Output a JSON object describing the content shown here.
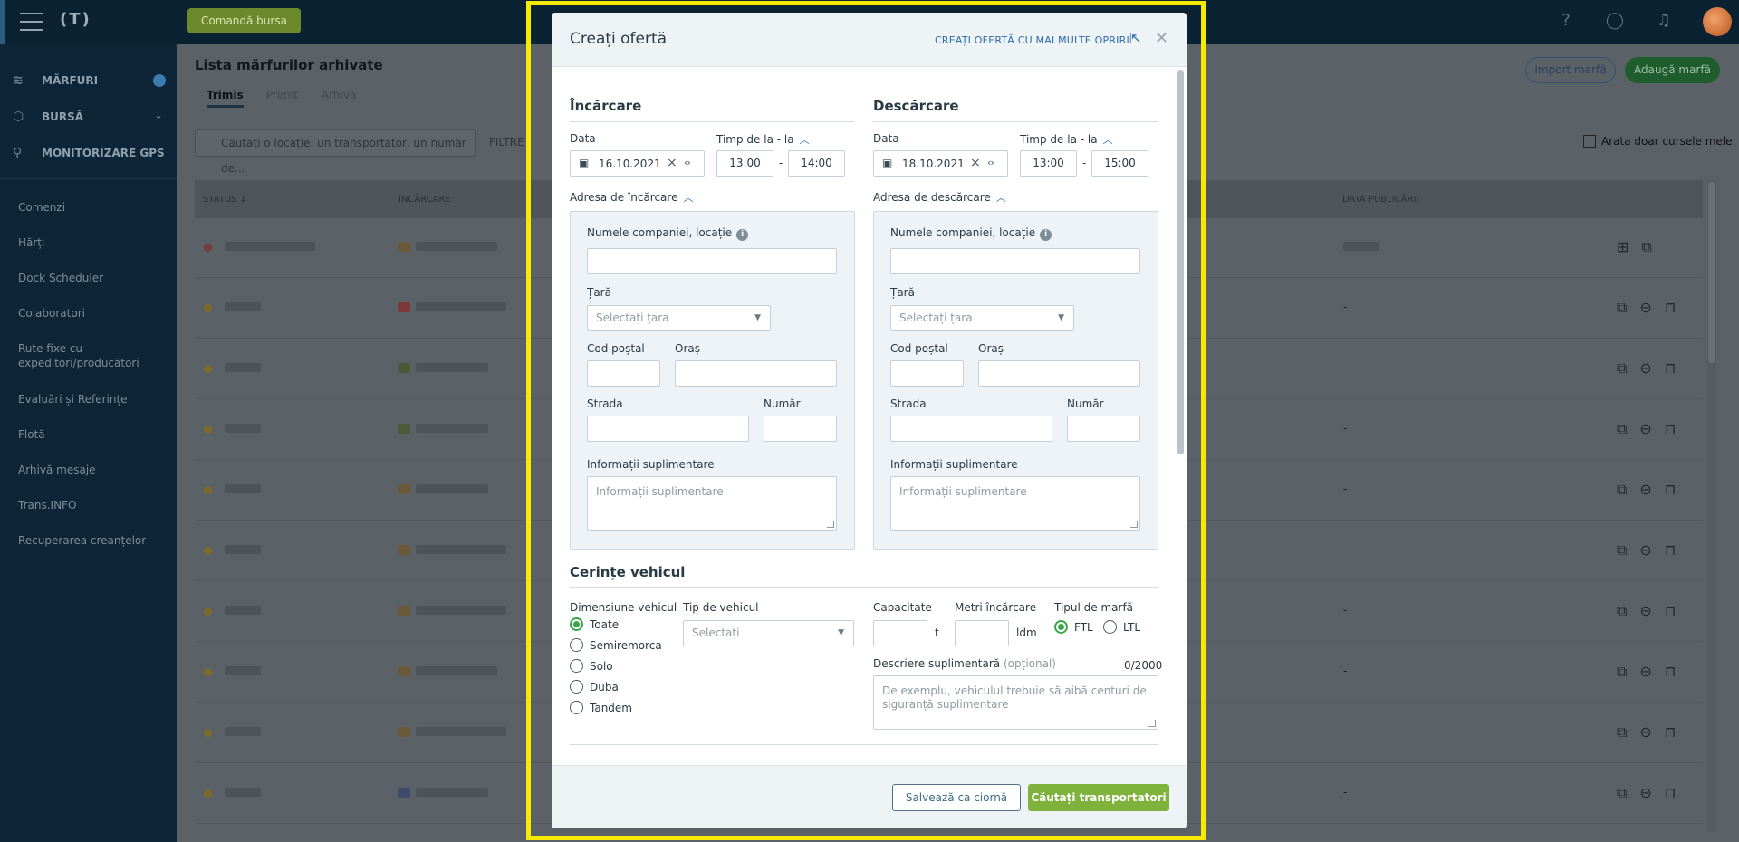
{
  "topbar": {
    "logo": "(T)",
    "order_button": "Comandă bursa"
  },
  "sidebar": {
    "main_items": [
      {
        "label": "MĂRFURI",
        "icon": "cargo-icon"
      },
      {
        "label": "BURSĂ",
        "icon": "exchange-icon"
      },
      {
        "label": "MONITORIZARE GPS",
        "icon": "gps-icon"
      }
    ],
    "sub_items": [
      "Comenzi",
      "Hărți",
      "Dock Scheduler",
      "Colaboratori",
      "Rute fixe cu expeditori/producători",
      "Evaluări și Referințe",
      "Flotă",
      "Arhivă mesaje",
      "Trans.INFO",
      "Recuperarea creanțelor"
    ]
  },
  "background": {
    "title": "Lista mărfurilor arhivate",
    "tabs": [
      "Trimis",
      "Primit",
      "Arhiva"
    ],
    "search_placeholder": "Căutați o locație, un transportator, un număr de...",
    "filter_label": "FILTRE",
    "import_button": "Import marfă",
    "add_button": "Adaugă marfă",
    "only_mine_label": "Arata doar cursele mele",
    "columns": [
      "STATUS ↓",
      "ÎNCĂRCARE",
      "DATA PUBLICĂRII"
    ],
    "row_dash": "-"
  },
  "modal": {
    "title": "Creați ofertă",
    "multi_stop_link": "CREAȚI OFERTĂ CU MAI MULTE OPRIRI",
    "loading": {
      "section_title": "Încărcare",
      "date_label": "Data",
      "date_value": "16.10.2021",
      "time_label": "Timp de la - la",
      "time_from": "13:00",
      "time_to": "14:00",
      "address_label": "Adresa de încărcare",
      "company_label": "Numele companiei, locație",
      "country_label": "Țară",
      "country_placeholder": "Selectați țara",
      "postal_label": "Cod poștal",
      "city_label": "Oraș",
      "street_label": "Strada",
      "number_label": "Număr",
      "extra_label": "Informații suplimentare",
      "extra_placeholder": "Informații suplimentare"
    },
    "unloading": {
      "section_title": "Descărcare",
      "date_label": "Data",
      "date_value": "18.10.2021",
      "time_label": "Timp de la - la",
      "time_from": "13:00",
      "time_to": "15:00",
      "address_label": "Adresa de descărcare",
      "company_label": "Numele companiei, locație",
      "country_label": "Țară",
      "country_placeholder": "Selectați țara",
      "postal_label": "Cod poștal",
      "city_label": "Oraș",
      "street_label": "Strada",
      "number_label": "Număr",
      "extra_label": "Informații suplimentare",
      "extra_placeholder": "Informații suplimentare"
    },
    "vehicle": {
      "section_title": "Cerințe vehicul",
      "size_label": "Dimensiune vehicul",
      "size_options": [
        "Toate",
        "Semiremorca",
        "Solo",
        "Duba",
        "Tandem"
      ],
      "size_selected": "Toate",
      "type_label": "Tip de vehicul",
      "type_placeholder": "Selectați",
      "capacity_label": "Capacitate",
      "capacity_unit": "t",
      "meters_label": "Metri încărcare",
      "meters_unit": "ldm",
      "cargo_type_label": "Tipul de marfă",
      "cargo_options": [
        "FTL",
        "LTL"
      ],
      "cargo_selected": "FTL",
      "description_label": "Descriere suplimentară",
      "description_optional": "(opțional)",
      "description_counter": "0/2000",
      "description_placeholder": "De exemplu, vehiculul trebuie să aibă centuri de siguranță suplimentare"
    },
    "footer": {
      "draft_button": "Salvează ca ciornă",
      "search_button": "Căutați transportatori"
    }
  },
  "colors": {
    "primary_green": "#7fb23c",
    "link_blue": "#2d6ca8",
    "highlight_frame": "#f6ea00"
  }
}
